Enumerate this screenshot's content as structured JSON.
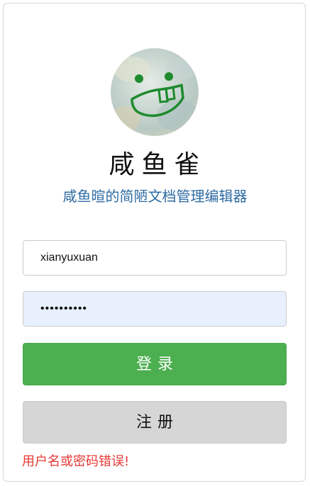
{
  "app": {
    "title": "咸鱼雀",
    "subtitle": "咸鱼暄的简陋文档管理编辑器"
  },
  "login_form": {
    "username_value": "xianyuxuan",
    "password_value": "••••••••••",
    "login_label": "登录",
    "register_label": "注册",
    "error_message": "用户名或密码错误!"
  },
  "colors": {
    "login_button": "#4caf50",
    "register_button": "#d6d6d6",
    "subtitle": "#2e6ba3",
    "error": "#e53935",
    "password_autofill": "#e8f0fe"
  }
}
